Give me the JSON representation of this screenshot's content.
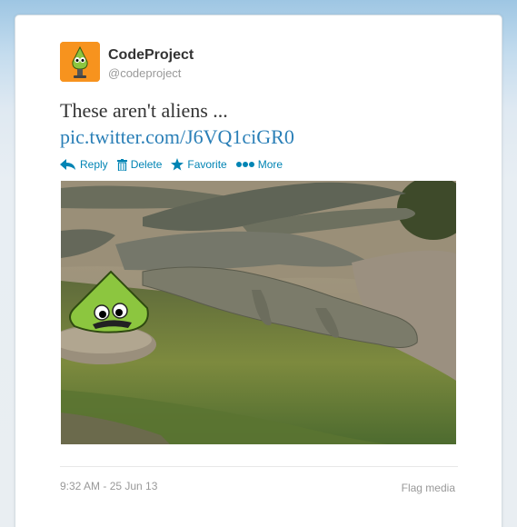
{
  "author": {
    "display_name": "CodeProject",
    "screen_name": "@codeproject",
    "avatar_icon": "codeproject-bob-logo"
  },
  "tweet": {
    "text": "These aren't aliens ...",
    "link": "pic.twitter.com/J6VQ1ciGR0"
  },
  "actions": [
    {
      "label": "Reply",
      "icon": "reply-icon"
    },
    {
      "label": "Delete",
      "icon": "trash-icon"
    },
    {
      "label": "Favorite",
      "icon": "star-icon"
    },
    {
      "label": "More",
      "icon": "more-dots-icon"
    }
  ],
  "media": {
    "subject": "crocodiles-with-codeproject-mascot"
  },
  "footer": {
    "timestamp": "9:32 AM - 25 Jun 13",
    "flag_label": "Flag media"
  },
  "colors": {
    "link": "#2a7fb7",
    "action": "#0084b4",
    "avatar_bg": "#f7931e",
    "muted_text": "#999999"
  }
}
